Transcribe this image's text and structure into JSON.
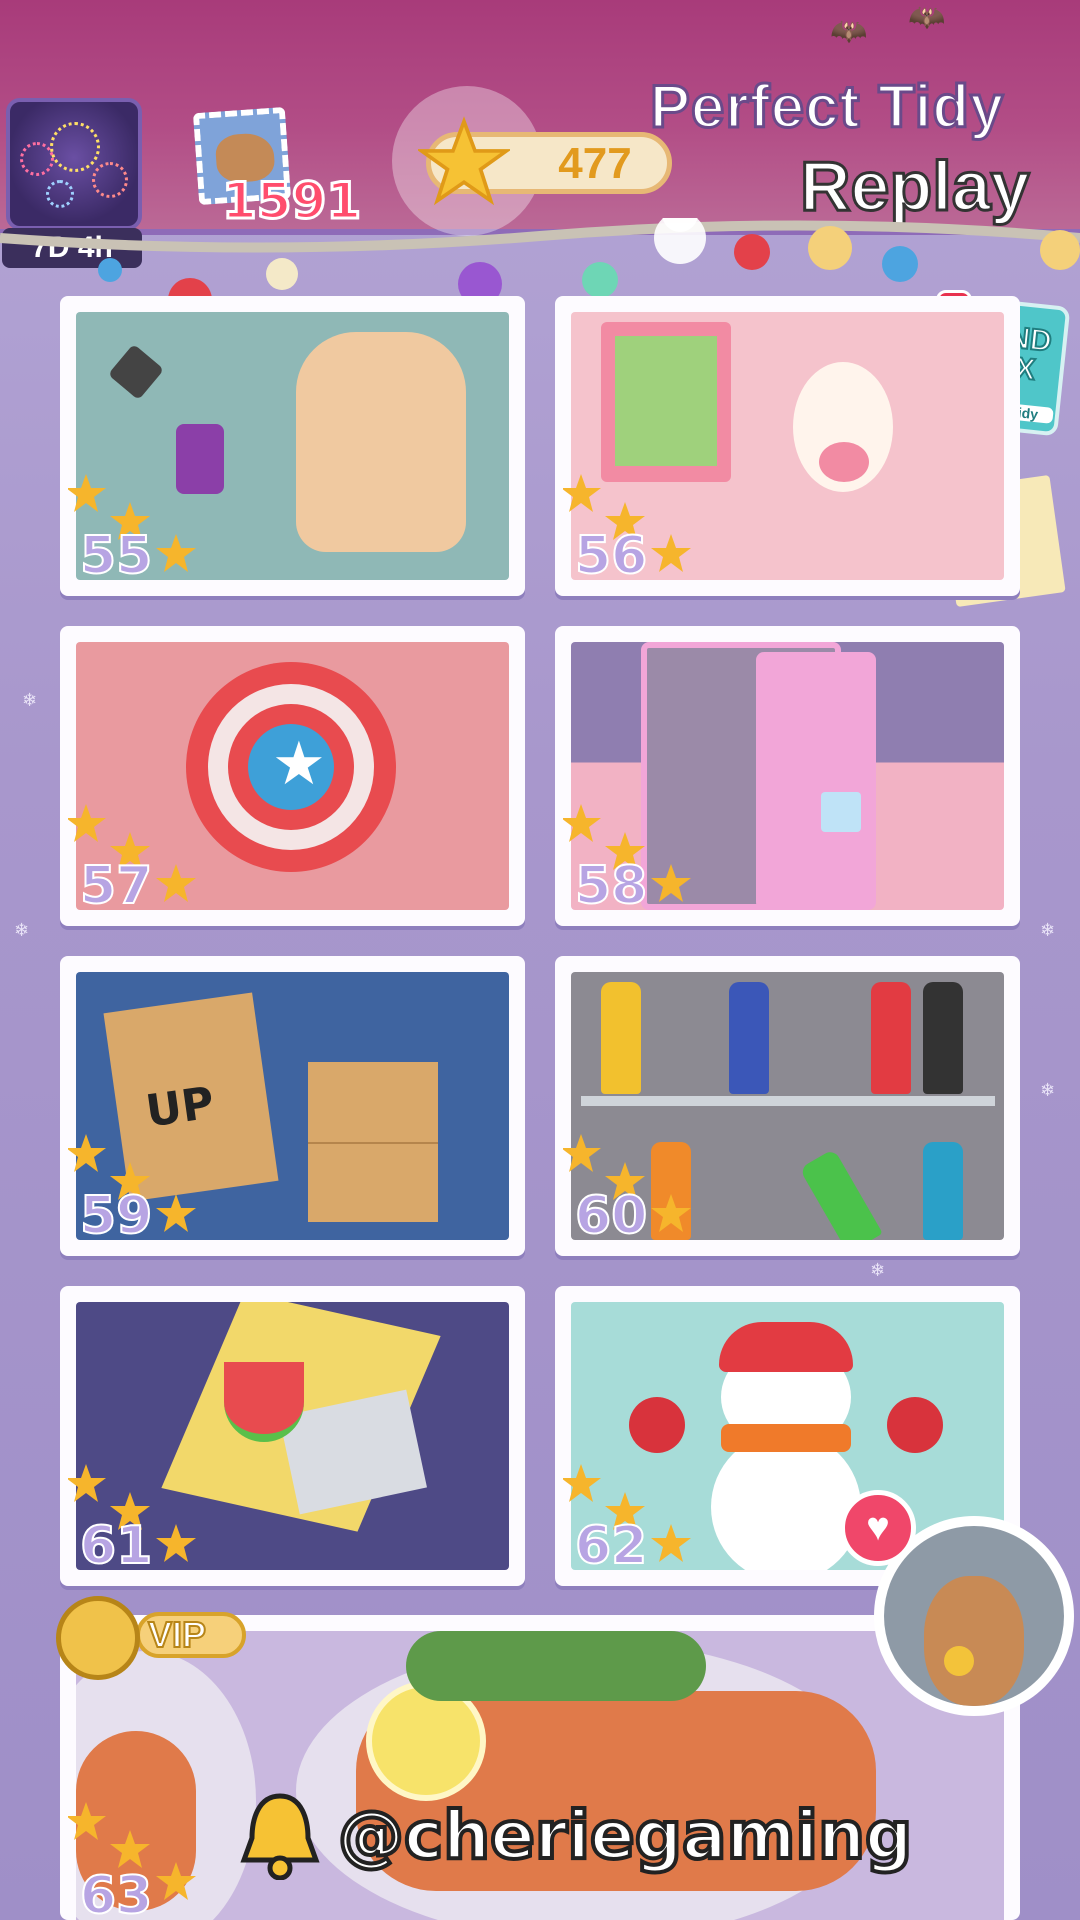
{
  "header": {
    "event_timer": "7D 4h",
    "coins": "1591",
    "stars": "477",
    "brand_title": "Perfect Tidy",
    "brand_subtitle": "Replay"
  },
  "side_items": {
    "blind_box_label": "BLIND BOX",
    "blind_box_sub": "Perfect Tidy",
    "alert_glyph": "!"
  },
  "levels": [
    {
      "number": "55",
      "stars": 3,
      "theme": "nail-polish"
    },
    {
      "number": "56",
      "stars": 3,
      "theme": "bedroom"
    },
    {
      "number": "57",
      "stars": 3,
      "theme": "shield"
    },
    {
      "number": "58",
      "stars": 3,
      "theme": "pc-case"
    },
    {
      "number": "59",
      "stars": 3,
      "theme": "boxes"
    },
    {
      "number": "60",
      "stars": 3,
      "theme": "spray-cans"
    },
    {
      "number": "61",
      "stars": 3,
      "theme": "watermelon-paper"
    },
    {
      "number": "62",
      "stars": 3,
      "theme": "snowman"
    }
  ],
  "vip_level": {
    "number": "63",
    "badge": "VIP",
    "stars": 3
  },
  "watermark": "@cheriegaming",
  "colors": {
    "header_top": "#a83b7a",
    "background": "#a99ccd",
    "level_number": "#b7a4e3",
    "star": "#f6b52c",
    "accent_red": "#e8324f"
  }
}
